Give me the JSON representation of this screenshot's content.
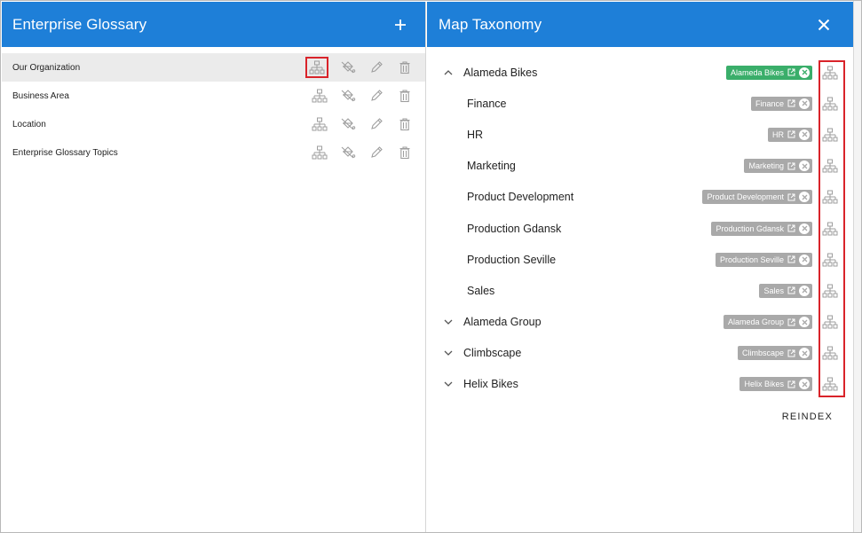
{
  "colors": {
    "header_bg": "#1e7fd8",
    "header_text": "#ffffff",
    "selected_row": "#ebebeb",
    "chip_grey": "#a9a9a9",
    "chip_green": "#3aae6a",
    "highlight_red": "#d9232a",
    "icon_grey": "#9e9e9e"
  },
  "left_panel": {
    "title": "Enterprise Glossary",
    "add_icon": "plus-icon",
    "rows": [
      {
        "label": "Our Organization",
        "selected": true
      },
      {
        "label": "Business Area",
        "selected": false
      },
      {
        "label": "Location",
        "selected": false
      },
      {
        "label": "Enterprise Glossary Topics",
        "selected": false
      }
    ],
    "row_actions": [
      "taxonomy-icon",
      "fill-off-icon",
      "pencil-icon",
      "trash-icon"
    ]
  },
  "right_panel": {
    "title": "Map Taxonomy",
    "close_icon": "close-icon",
    "items": [
      {
        "label": "Alameda Bikes",
        "chip": "Alameda Bikes",
        "level": 0,
        "chevron": "up",
        "chip_color": "green"
      },
      {
        "label": "Finance",
        "chip": "Finance",
        "level": 1,
        "chevron": "",
        "chip_color": "grey"
      },
      {
        "label": "HR",
        "chip": "HR",
        "level": 1,
        "chevron": "",
        "chip_color": "grey"
      },
      {
        "label": "Marketing",
        "chip": "Marketing",
        "level": 1,
        "chevron": "",
        "chip_color": "grey"
      },
      {
        "label": "Product Development",
        "chip": "Product Development",
        "level": 1,
        "chevron": "",
        "chip_color": "grey"
      },
      {
        "label": "Production Gdansk",
        "chip": "Production Gdansk",
        "level": 1,
        "chevron": "",
        "chip_color": "grey"
      },
      {
        "label": "Production Seville",
        "chip": "Production Seville",
        "level": 1,
        "chevron": "",
        "chip_color": "grey"
      },
      {
        "label": "Sales",
        "chip": "Sales",
        "level": 1,
        "chevron": "",
        "chip_color": "grey"
      },
      {
        "label": "Alameda Group",
        "chip": "Alameda Group",
        "level": 0,
        "chevron": "down",
        "chip_color": "grey"
      },
      {
        "label": "Climbscape",
        "chip": "Climbscape",
        "level": 0,
        "chevron": "down",
        "chip_color": "grey"
      },
      {
        "label": "Helix Bikes",
        "chip": "Helix Bikes",
        "level": 0,
        "chevron": "down",
        "chip_color": "grey"
      }
    ],
    "reindex_label": "REINDEX"
  }
}
